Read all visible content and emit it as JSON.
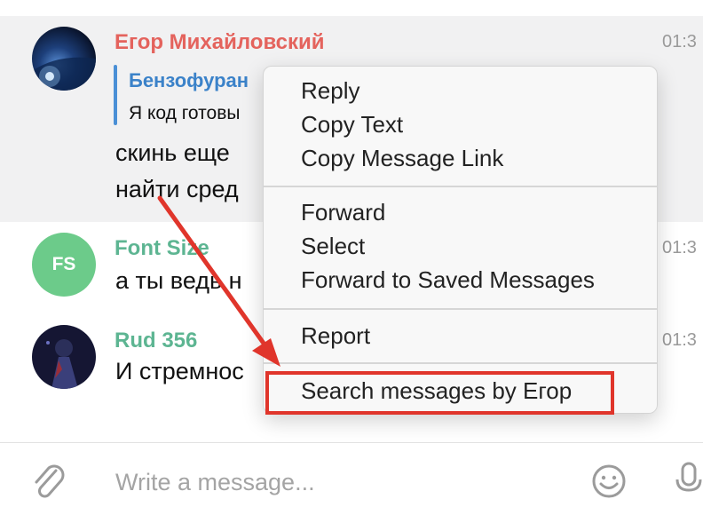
{
  "messages": [
    {
      "sender": "Егор Михайловский",
      "sender_color": "#e4635d",
      "time": "01:3",
      "reply": {
        "name": "Бензофуран",
        "text": "Я код готовы"
      },
      "lines": [
        "скинь еще",
        "найти сред"
      ]
    },
    {
      "sender": "Font Size",
      "sender_color": "#5db592",
      "avatar_initials": "FS",
      "avatar_color": "#6ccb8a",
      "time": "01:3",
      "lines": [
        "а ты ведь н"
      ]
    },
    {
      "sender": "Rud 356",
      "sender_color": "#5db592",
      "time": "01:3",
      "lines": [
        "И стремнос"
      ]
    }
  ],
  "context_menu": {
    "group1": [
      "Reply",
      "Copy Text",
      "Copy Message Link"
    ],
    "group2": [
      "Forward",
      "Select",
      "Forward to Saved Messages"
    ],
    "group3": [
      "Report"
    ],
    "group4": [
      "Search messages by Егор"
    ]
  },
  "annotation_color": "#e0352b",
  "composer": {
    "placeholder": "Write a message..."
  },
  "icons": [
    "paperclip-icon",
    "emoji-icon",
    "microphone-icon"
  ]
}
